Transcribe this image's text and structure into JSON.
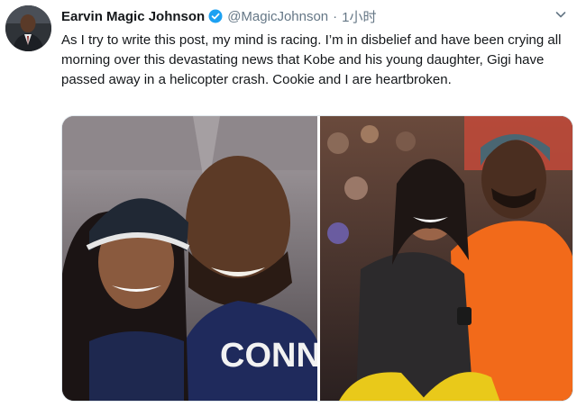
{
  "tweet": {
    "author_name": "Earvin Magic Johnson",
    "handle": "@MagicJohnson",
    "separator": "·",
    "time": "1小时",
    "verified_icon": "verified-badge-icon",
    "menu_icon": "chevron-down-icon",
    "text": "As I try to write this post, my mind is racing. I’m in disbelief and have been crying all morning over this devastating news that Kobe and his young daughter, Gigi have passed away in a helicopter crash. Cookie and I are heartbroken.",
    "colors": {
      "verified": "#1da1f2",
      "secondary_text": "#657786",
      "primary_text": "#14171a"
    }
  },
  "media": {
    "photos": [
      {
        "kind": "photo",
        "shirt_text": "CONN"
      },
      {
        "kind": "photo"
      }
    ]
  }
}
